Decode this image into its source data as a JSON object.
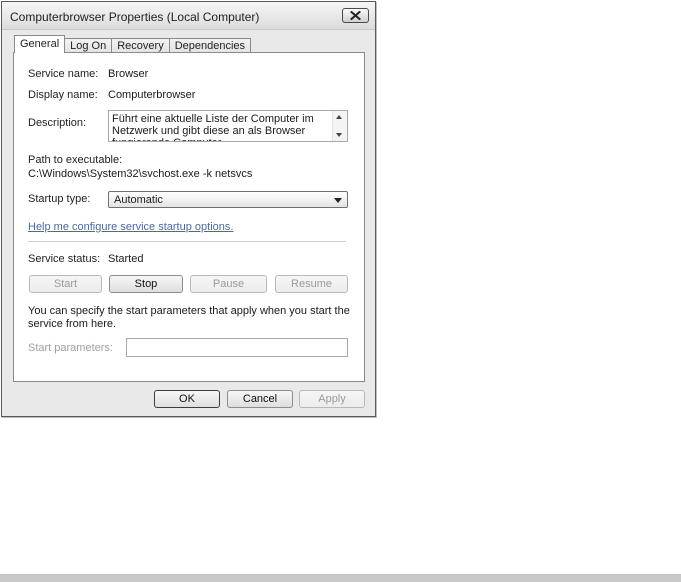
{
  "window": {
    "title": "Computerbrowser Properties (Local Computer)"
  },
  "tabs": [
    {
      "label": "General"
    },
    {
      "label": "Log On"
    },
    {
      "label": "Recovery"
    },
    {
      "label": "Dependencies"
    }
  ],
  "general": {
    "service_name_label": "Service name:",
    "service_name_value": "Browser",
    "display_name_label": "Display name:",
    "display_name_value": "Computerbrowser",
    "description_label": "Description:",
    "description_value": "Führt eine aktuelle Liste der Computer im Netzwerk und gibt diese an als Browser fungierende Computer",
    "path_label": "Path to executable:",
    "path_value": "C:\\Windows\\System32\\svchost.exe -k netsvcs",
    "startup_type_label": "Startup type:",
    "startup_type_value": "Automatic",
    "help_link": "Help me configure service startup options.",
    "service_status_label": "Service status:",
    "service_status_value": "Started",
    "start_label": "Start",
    "stop_label": "Stop",
    "pause_label": "Pause",
    "resume_label": "Resume",
    "params_text": "You can specify the start parameters that apply when you start the service from here.",
    "start_params_label": "Start parameters:",
    "start_params_value": ""
  },
  "footer": {
    "ok_label": "OK",
    "cancel_label": "Cancel",
    "apply_label": "Apply"
  }
}
